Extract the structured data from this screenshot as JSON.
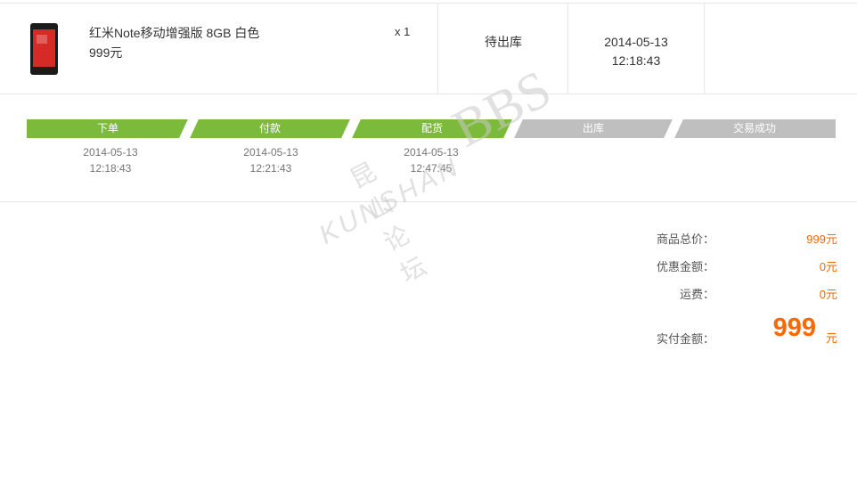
{
  "product": {
    "name": "红米Note移动增强版 8GB 白色",
    "price": "999元",
    "qty": "x 1"
  },
  "order": {
    "status": "待出库",
    "date": "2014-05-13",
    "time": "12:18:43"
  },
  "progress": {
    "steps": [
      {
        "label": "下单",
        "date": "2014-05-13",
        "time": "12:18:43",
        "done": true
      },
      {
        "label": "付款",
        "date": "2014-05-13",
        "time": "12:21:43",
        "done": true
      },
      {
        "label": "配货",
        "date": "2014-05-13",
        "time": "12:47:45",
        "done": true
      },
      {
        "label": "出库",
        "date": "",
        "time": "",
        "done": false
      },
      {
        "label": "交易成功",
        "date": "",
        "time": "",
        "done": false
      }
    ],
    "colors": {
      "done": "#7cba3c",
      "todo": "#bfbfbf"
    }
  },
  "summary": {
    "subtotal_label": "商品总价：",
    "subtotal_value": "999元",
    "discount_label": "优惠金额：",
    "discount_value": "0元",
    "shipping_label": "运费：",
    "shipping_value": "0元",
    "total_label": "实付金额：",
    "total_value": "999",
    "total_unit": "元"
  },
  "watermark": {
    "cn": "昆山论坛",
    "en": "KUNSHAN",
    "bbs": "BBS"
  },
  "accent_color": "#ff6700"
}
